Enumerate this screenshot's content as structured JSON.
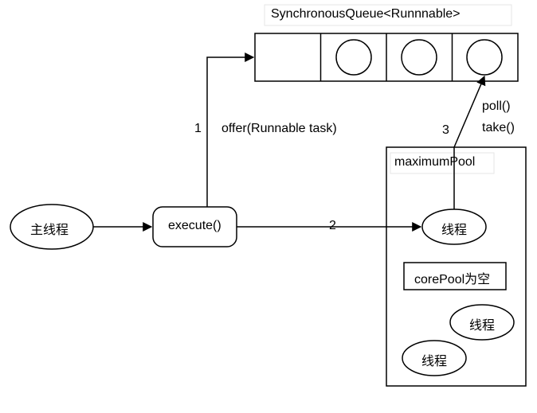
{
  "title": "SynchronousQueue<Runnnable>",
  "nodes": {
    "main_thread": "主线程",
    "execute": "execute()",
    "maximum_pool": "maximumPool",
    "core_pool_empty": "corePool为空",
    "thread_center": "线程",
    "thread_right": "线程",
    "thread_bottom": "线程"
  },
  "edges": {
    "e1": {
      "num": "1",
      "label": "offer(Runnable task)"
    },
    "e2": {
      "num": "2"
    },
    "e3": {
      "num": "3",
      "label_top": "poll()",
      "label_bottom": "take()"
    }
  }
}
